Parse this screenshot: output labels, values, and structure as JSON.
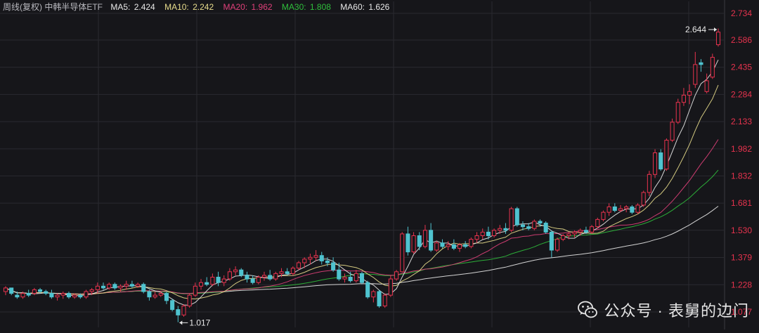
{
  "legend": {
    "title": "周线(复权)  中韩半导体ETF",
    "items": [
      {
        "label": "MA5:",
        "value": "2.424",
        "color": "#e8e8e8"
      },
      {
        "label": "MA10:",
        "value": "2.242",
        "color": "#e8dd8c"
      },
      {
        "label": "MA20:",
        "value": "1.962",
        "color": "#e0407a"
      },
      {
        "label": "MA30:",
        "value": "1.808",
        "color": "#2fbf3c"
      },
      {
        "label": "MA60:",
        "value": "1.626",
        "color": "#e8e8e8"
      }
    ]
  },
  "watermark": {
    "text": "公众号 · 表舅的边门",
    "icon": "wechat-icon"
  },
  "colors": {
    "up": "#e8334e",
    "down": "#4fc3cf",
    "axis_text": "#e8334e",
    "grid": "#2a2a30",
    "background": "#16161a"
  },
  "chart_data": {
    "type": "candlestick",
    "y_ticks": [
      "2.734",
      "2.586",
      "2.435",
      "2.284",
      "2.133",
      "1.982",
      "1.832",
      "1.681",
      "1.530",
      "1.379",
      "1.228",
      "1.077"
    ],
    "ylim": [
      1.05,
      2.76
    ],
    "grid": true,
    "annotations": {
      "max": {
        "label": "2.644",
        "value": 2.644
      },
      "min": {
        "label": "1.017",
        "value": 1.017
      }
    },
    "candles": [
      [
        1.19,
        1.22,
        1.17,
        1.21
      ],
      [
        1.21,
        1.21,
        1.17,
        1.18
      ],
      [
        1.17,
        1.19,
        1.15,
        1.16
      ],
      [
        1.16,
        1.19,
        1.15,
        1.18
      ],
      [
        1.18,
        1.2,
        1.16,
        1.17
      ],
      [
        1.18,
        1.21,
        1.17,
        1.2
      ],
      [
        1.2,
        1.21,
        1.18,
        1.19
      ],
      [
        1.19,
        1.2,
        1.17,
        1.18
      ],
      [
        1.18,
        1.2,
        1.15,
        1.16
      ],
      [
        1.16,
        1.18,
        1.14,
        1.17
      ],
      [
        1.17,
        1.19,
        1.15,
        1.18
      ],
      [
        1.18,
        1.19,
        1.15,
        1.16
      ],
      [
        1.16,
        1.18,
        1.15,
        1.17
      ],
      [
        1.17,
        1.18,
        1.15,
        1.16
      ],
      [
        1.16,
        1.2,
        1.15,
        1.19
      ],
      [
        1.19,
        1.21,
        1.17,
        1.2
      ],
      [
        1.2,
        1.24,
        1.18,
        1.22
      ],
      [
        1.22,
        1.24,
        1.2,
        1.21
      ],
      [
        1.21,
        1.24,
        1.2,
        1.23
      ],
      [
        1.23,
        1.24,
        1.2,
        1.21
      ],
      [
        1.21,
        1.23,
        1.19,
        1.22
      ],
      [
        1.22,
        1.25,
        1.2,
        1.23
      ],
      [
        1.23,
        1.25,
        1.21,
        1.22
      ],
      [
        1.22,
        1.24,
        1.21,
        1.23
      ],
      [
        1.23,
        1.24,
        1.18,
        1.19
      ],
      [
        1.19,
        1.2,
        1.14,
        1.16
      ],
      [
        1.16,
        1.19,
        1.15,
        1.17
      ],
      [
        1.17,
        1.19,
        1.16,
        1.18
      ],
      [
        1.18,
        1.19,
        1.12,
        1.14
      ],
      [
        1.14,
        1.15,
        1.08,
        1.09
      ],
      [
        1.09,
        1.11,
        1.02,
        1.06
      ],
      [
        1.06,
        1.12,
        1.05,
        1.11
      ],
      [
        1.11,
        1.18,
        1.1,
        1.17
      ],
      [
        1.17,
        1.24,
        1.16,
        1.22
      ],
      [
        1.22,
        1.26,
        1.2,
        1.24
      ],
      [
        1.24,
        1.27,
        1.22,
        1.23
      ],
      [
        1.23,
        1.29,
        1.22,
        1.27
      ],
      [
        1.27,
        1.3,
        1.22,
        1.24
      ],
      [
        1.24,
        1.28,
        1.22,
        1.26
      ],
      [
        1.26,
        1.32,
        1.25,
        1.3
      ],
      [
        1.3,
        1.33,
        1.28,
        1.31
      ],
      [
        1.31,
        1.32,
        1.27,
        1.28
      ],
      [
        1.28,
        1.3,
        1.24,
        1.26
      ],
      [
        1.26,
        1.28,
        1.23,
        1.24
      ],
      [
        1.24,
        1.28,
        1.23,
        1.27
      ],
      [
        1.27,
        1.3,
        1.25,
        1.28
      ],
      [
        1.28,
        1.31,
        1.25,
        1.26
      ],
      [
        1.26,
        1.3,
        1.25,
        1.29
      ],
      [
        1.29,
        1.32,
        1.27,
        1.3
      ],
      [
        1.3,
        1.32,
        1.28,
        1.29
      ],
      [
        1.29,
        1.33,
        1.28,
        1.32
      ],
      [
        1.32,
        1.36,
        1.31,
        1.35
      ],
      [
        1.35,
        1.38,
        1.32,
        1.37
      ],
      [
        1.37,
        1.4,
        1.34,
        1.38
      ],
      [
        1.38,
        1.42,
        1.36,
        1.39
      ],
      [
        1.39,
        1.41,
        1.34,
        1.36
      ],
      [
        1.36,
        1.38,
        1.33,
        1.35
      ],
      [
        1.35,
        1.38,
        1.3,
        1.31
      ],
      [
        1.31,
        1.35,
        1.25,
        1.26
      ],
      [
        1.26,
        1.29,
        1.24,
        1.27
      ],
      [
        1.27,
        1.3,
        1.24,
        1.25
      ],
      [
        1.25,
        1.31,
        1.24,
        1.29
      ],
      [
        1.29,
        1.3,
        1.23,
        1.24
      ],
      [
        1.24,
        1.25,
        1.15,
        1.16
      ],
      [
        1.16,
        1.2,
        1.13,
        1.19
      ],
      [
        1.19,
        1.2,
        1.1,
        1.11
      ],
      [
        1.11,
        1.18,
        1.1,
        1.17
      ],
      [
        1.17,
        1.28,
        1.16,
        1.26
      ],
      [
        1.26,
        1.31,
        1.25,
        1.3
      ],
      [
        1.3,
        1.52,
        1.3,
        1.51
      ],
      [
        1.51,
        1.55,
        1.39,
        1.41
      ],
      [
        1.41,
        1.52,
        1.4,
        1.5
      ],
      [
        1.5,
        1.52,
        1.42,
        1.44
      ],
      [
        1.44,
        1.56,
        1.43,
        1.53
      ],
      [
        1.53,
        1.57,
        1.41,
        1.42
      ],
      [
        1.42,
        1.47,
        1.41,
        1.46
      ],
      [
        1.46,
        1.48,
        1.43,
        1.44
      ],
      [
        1.44,
        1.47,
        1.42,
        1.45
      ],
      [
        1.45,
        1.48,
        1.42,
        1.43
      ],
      [
        1.43,
        1.46,
        1.41,
        1.45
      ],
      [
        1.45,
        1.47,
        1.43,
        1.44
      ],
      [
        1.44,
        1.49,
        1.43,
        1.48
      ],
      [
        1.48,
        1.52,
        1.46,
        1.5
      ],
      [
        1.5,
        1.54,
        1.48,
        1.52
      ],
      [
        1.52,
        1.55,
        1.48,
        1.5
      ],
      [
        1.5,
        1.54,
        1.49,
        1.53
      ],
      [
        1.53,
        1.56,
        1.51,
        1.54
      ],
      [
        1.54,
        1.57,
        1.51,
        1.53
      ],
      [
        1.53,
        1.66,
        1.52,
        1.65
      ],
      [
        1.65,
        1.66,
        1.55,
        1.56
      ],
      [
        1.56,
        1.58,
        1.53,
        1.55
      ],
      [
        1.55,
        1.57,
        1.53,
        1.54
      ],
      [
        1.54,
        1.59,
        1.53,
        1.58
      ],
      [
        1.58,
        1.59,
        1.55,
        1.57
      ],
      [
        1.57,
        1.58,
        1.51,
        1.52
      ],
      [
        1.52,
        1.53,
        1.38,
        1.42
      ],
      [
        1.42,
        1.49,
        1.41,
        1.48
      ],
      [
        1.48,
        1.51,
        1.47,
        1.5
      ],
      [
        1.5,
        1.52,
        1.48,
        1.51
      ],
      [
        1.51,
        1.53,
        1.49,
        1.52
      ],
      [
        1.52,
        1.54,
        1.5,
        1.53
      ],
      [
        1.53,
        1.55,
        1.51,
        1.52
      ],
      [
        1.52,
        1.56,
        1.51,
        1.55
      ],
      [
        1.55,
        1.6,
        1.54,
        1.59
      ],
      [
        1.59,
        1.64,
        1.58,
        1.63
      ],
      [
        1.63,
        1.68,
        1.61,
        1.66
      ],
      [
        1.66,
        1.68,
        1.63,
        1.64
      ],
      [
        1.64,
        1.67,
        1.63,
        1.65
      ],
      [
        1.65,
        1.67,
        1.63,
        1.66
      ],
      [
        1.66,
        1.67,
        1.62,
        1.63
      ],
      [
        1.63,
        1.68,
        1.62,
        1.67
      ],
      [
        1.67,
        1.75,
        1.66,
        1.74
      ],
      [
        1.74,
        1.86,
        1.72,
        1.84
      ],
      [
        1.84,
        1.98,
        1.82,
        1.96
      ],
      [
        1.96,
        1.98,
        1.86,
        1.87
      ],
      [
        1.87,
        2.04,
        1.86,
        2.03
      ],
      [
        2.03,
        2.15,
        2.02,
        2.13
      ],
      [
        2.13,
        2.26,
        2.12,
        2.24
      ],
      [
        2.24,
        2.32,
        2.22,
        2.28
      ],
      [
        2.28,
        2.34,
        2.23,
        2.3
      ],
      [
        2.34,
        2.52,
        2.32,
        2.45
      ],
      [
        2.46,
        2.48,
        2.41,
        2.45
      ],
      [
        2.3,
        2.4,
        2.29,
        2.36
      ],
      [
        2.38,
        2.51,
        2.37,
        2.49
      ],
      [
        2.56,
        2.65,
        2.55,
        2.63
      ]
    ]
  }
}
